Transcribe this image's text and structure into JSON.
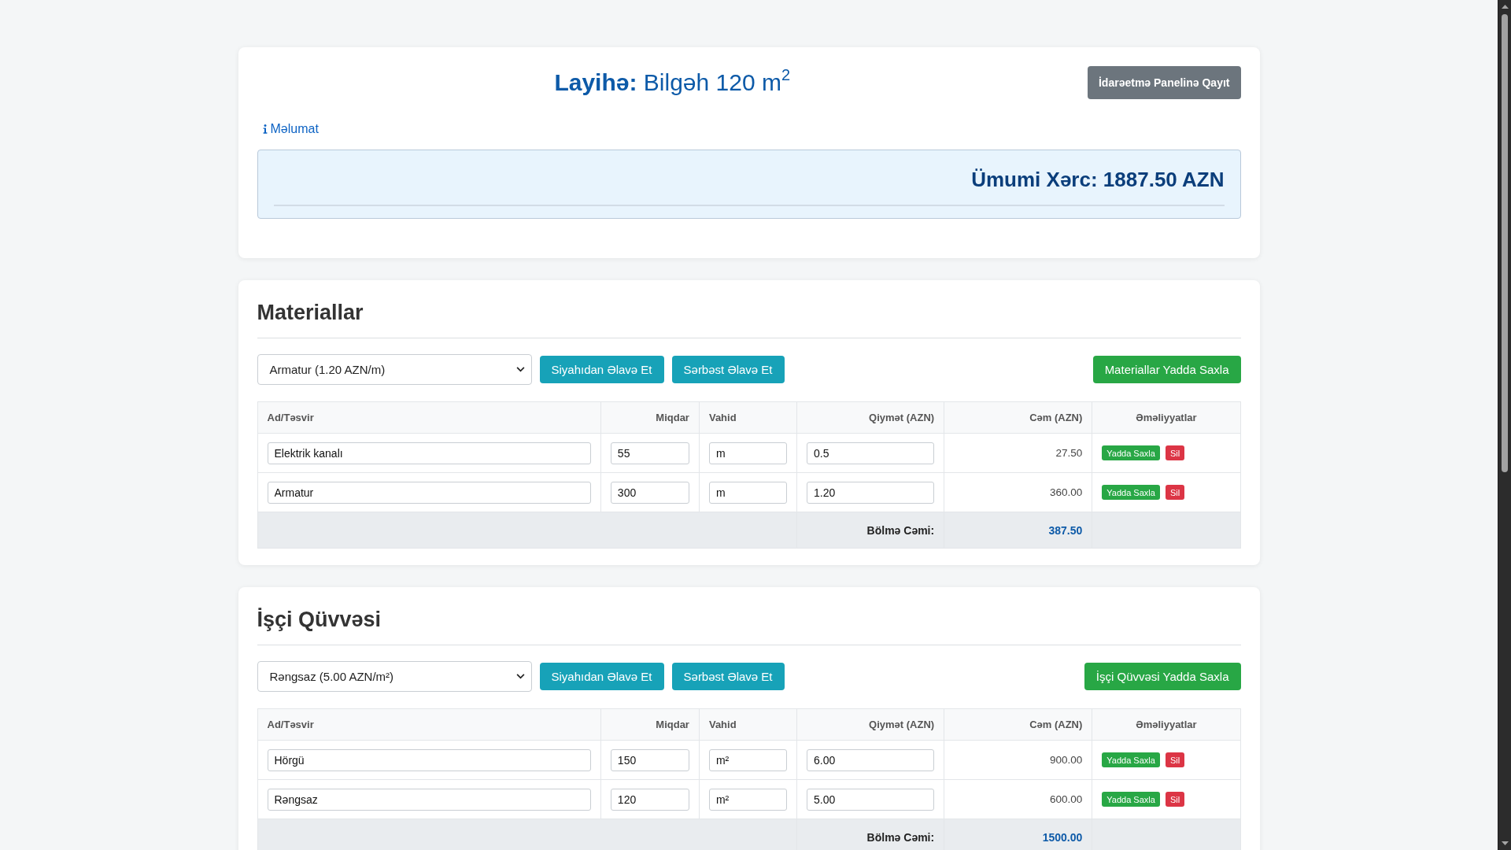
{
  "header": {
    "title": "**Layihə:** Bilgəh 120 m$^{2}$",
    "back_button": "İdarəetmə Panelinə Qayıt"
  },
  "info_link": {
    "label": "Məlumat"
  },
  "summary": {
    "total": "Ümumi Xərc: 1887.50 AZN"
  },
  "sections": [
    {
      "title": "Materiallar",
      "select": {
        "value": "Armatur (1.20 AZN/m)"
      },
      "buttons": [
        {
          "label": "Siyahıdan Əlavə Et",
          "kind": "add"
        },
        {
          "label": "Sərbəst Əlavə Et",
          "kind": "add"
        },
        {
          "label": "Materiallar Yadda Saxla",
          "kind": "save"
        }
      ],
      "table": {
        "columns": [
          "Ad/Təsvir",
          "Miqdar",
          "Vahid",
          "Qiymət (AZN)",
          "Cəm (AZN)",
          "Əməliyyatlar"
        ],
        "rows": [
          {
            "name": "Elektrik kanalı",
            "quantity": "55",
            "unit": "m",
            "price": "0.5",
            "total": "27.50",
            "actions": [
              {
                "label": "Yadda Saxla",
                "kind": "save"
              },
              {
                "label": "Sil",
                "kind": "delete"
              }
            ]
          },
          {
            "name": "Armatur",
            "quantity": "300",
            "unit": "m",
            "price": "1.20",
            "total": "360.00",
            "actions": [
              {
                "label": "Yadda Saxla",
                "kind": "save"
              },
              {
                "label": "Sil",
                "kind": "delete"
              }
            ]
          }
        ],
        "footer": {
          "label": "Bölmə Cəmi:",
          "value": "387.50"
        }
      }
    },
    {
      "title": "İşçi Qüvvəsi",
      "select": {
        "value": "Rəngsaz (5.00 AZN/m²)"
      },
      "buttons": [
        {
          "label": "Siyahıdan Əlavə Et",
          "kind": "add"
        },
        {
          "label": "Sərbəst Əlavə Et",
          "kind": "add"
        },
        {
          "label": "İşçi Qüvvəsi Yadda Saxla",
          "kind": "save"
        }
      ],
      "table": {
        "columns": [
          "Ad/Təsvir",
          "Miqdar",
          "Vahid",
          "Qiymət (AZN)",
          "Cəm (AZN)",
          "Əməliyyatlar"
        ],
        "rows": [
          {
            "name": "Hörgü",
            "quantity": "150",
            "unit": "m²",
            "price": "6.00",
            "total": "900.00",
            "actions": [
              {
                "label": "Yadda Saxla",
                "kind": "save"
              },
              {
                "label": "Sil",
                "kind": "delete"
              }
            ]
          },
          {
            "name": "Rəngsaz",
            "quantity": "120",
            "unit": "m²",
            "price": "5.00",
            "total": "600.00",
            "actions": [
              {
                "label": "Yadda Saxla",
                "kind": "save"
              },
              {
                "label": "Sil",
                "kind": "delete"
              }
            ]
          }
        ],
        "footer": {
          "label": "Bölmə Cəmi:",
          "value": "1500.00"
        }
      }
    }
  ]
}
